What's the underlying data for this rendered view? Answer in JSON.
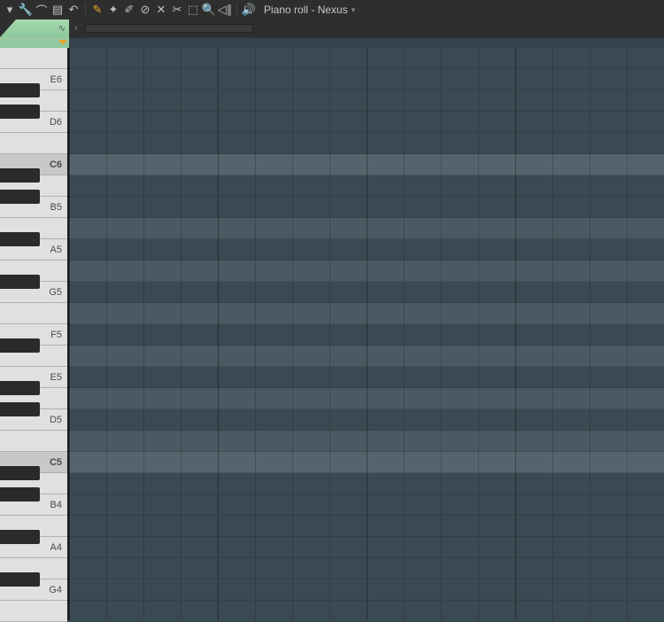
{
  "toolbar": {
    "title": "Piano roll - Nexus",
    "icons": [
      {
        "name": "dropdown-icon",
        "glyph": "▾",
        "orange": false
      },
      {
        "name": "wrench-icon",
        "glyph": "🔧",
        "orange": false
      },
      {
        "name": "snap-icon",
        "glyph": "⌒",
        "orange": false
      },
      {
        "name": "stamp-icon",
        "glyph": "▤",
        "orange": false
      },
      {
        "name": "undo-icon",
        "glyph": "↶",
        "orange": false
      },
      {
        "sep": true
      },
      {
        "name": "draw-icon",
        "glyph": "✎",
        "orange": true
      },
      {
        "name": "paint-icon",
        "glyph": "✦",
        "orange": false
      },
      {
        "name": "brush-icon",
        "glyph": "✐",
        "orange": false
      },
      {
        "name": "delete-icon",
        "glyph": "⊘",
        "orange": false
      },
      {
        "name": "mute-icon",
        "glyph": "✕",
        "orange": false
      },
      {
        "name": "slice-icon",
        "glyph": "✂",
        "orange": false
      },
      {
        "name": "select-icon",
        "glyph": "⬚",
        "orange": false
      },
      {
        "name": "zoom-icon",
        "glyph": "🔍",
        "orange": false
      },
      {
        "name": "playback-icon",
        "glyph": "◁∥",
        "orange": false
      },
      {
        "sep": true
      },
      {
        "name": "speaker-icon",
        "glyph": "🔊",
        "orange": false
      }
    ]
  },
  "notes": [
    {
      "label": "",
      "black_above": false,
      "highlight": false,
      "is_c": false
    },
    {
      "label": "E6",
      "black_above": false,
      "highlight": false,
      "is_c": false
    },
    {
      "label": "",
      "black_above": true,
      "highlight": false,
      "is_c": false
    },
    {
      "label": "D6",
      "black_above": true,
      "highlight": false,
      "is_c": false
    },
    {
      "label": "",
      "black_above": false,
      "highlight": false,
      "is_c": false
    },
    {
      "label": "C6",
      "black_above": false,
      "highlight": false,
      "is_c": true
    },
    {
      "label": "",
      "black_above": true,
      "highlight": false,
      "is_c": false
    },
    {
      "label": "B5",
      "black_above": true,
      "highlight": false,
      "is_c": false
    },
    {
      "label": "",
      "black_above": false,
      "highlight": true,
      "is_c": false
    },
    {
      "label": "A5",
      "black_above": true,
      "highlight": false,
      "is_c": false
    },
    {
      "label": "",
      "black_above": false,
      "highlight": true,
      "is_c": false
    },
    {
      "label": "G5",
      "black_above": true,
      "highlight": false,
      "is_c": false
    },
    {
      "label": "",
      "black_above": false,
      "highlight": true,
      "is_c": false
    },
    {
      "label": "F5",
      "black_above": false,
      "highlight": false,
      "is_c": false
    },
    {
      "label": "",
      "black_above": true,
      "highlight": true,
      "is_c": false
    },
    {
      "label": "E5",
      "black_above": false,
      "highlight": false,
      "is_c": false
    },
    {
      "label": "",
      "black_above": true,
      "highlight": true,
      "is_c": false
    },
    {
      "label": "D5",
      "black_above": true,
      "highlight": false,
      "is_c": false
    },
    {
      "label": "",
      "black_above": false,
      "highlight": true,
      "is_c": false
    },
    {
      "label": "C5",
      "black_above": false,
      "highlight": false,
      "is_c": true
    },
    {
      "label": "",
      "black_above": true,
      "highlight": false,
      "is_c": false
    },
    {
      "label": "B4",
      "black_above": true,
      "highlight": false,
      "is_c": false
    },
    {
      "label": "",
      "black_above": false,
      "highlight": false,
      "is_c": false
    },
    {
      "label": "A4",
      "black_above": true,
      "highlight": false,
      "is_c": false
    },
    {
      "label": "",
      "black_above": false,
      "highlight": false,
      "is_c": false
    },
    {
      "label": "G4",
      "black_above": true,
      "highlight": false,
      "is_c": false
    },
    {
      "label": "",
      "black_above": false,
      "highlight": false,
      "is_c": false
    }
  ],
  "grid": {
    "minor_spacing": 42,
    "major_every": 4,
    "count": 18
  }
}
